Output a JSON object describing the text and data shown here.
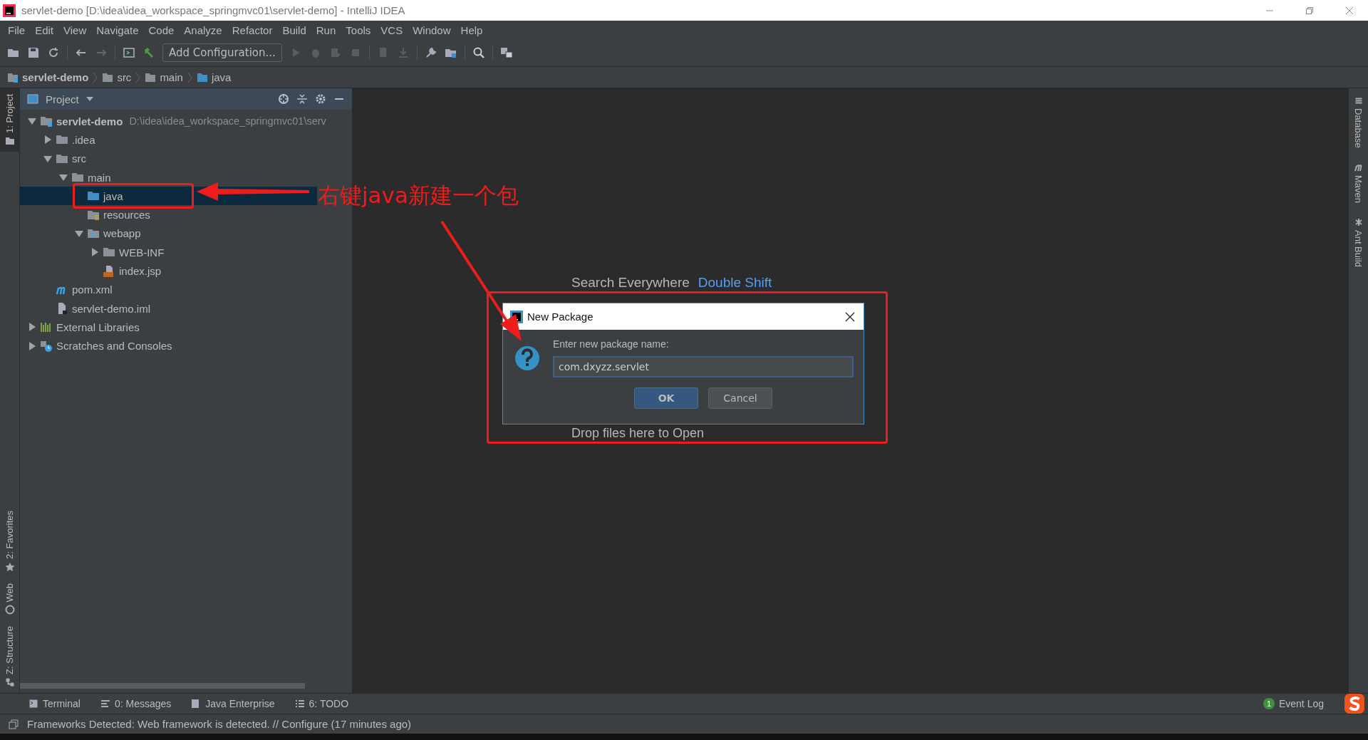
{
  "window": {
    "title": "servlet-demo [D:\\idea\\idea_workspace_springmvc01\\servlet-demo] - IntelliJ IDEA"
  },
  "menu": [
    "File",
    "Edit",
    "View",
    "Navigate",
    "Code",
    "Analyze",
    "Refactor",
    "Build",
    "Run",
    "Tools",
    "VCS",
    "Window",
    "Help"
  ],
  "toolbar": {
    "run_config": "Add Configuration..."
  },
  "breadcrumbs": [
    {
      "label": "servlet-demo",
      "kind": "module"
    },
    {
      "label": "src",
      "kind": "folder"
    },
    {
      "label": "main",
      "kind": "folder"
    },
    {
      "label": "java",
      "kind": "source"
    }
  ],
  "left_tabs": [
    {
      "label": "1: Project",
      "selected": true,
      "kind": "project"
    },
    {
      "label": "2: Favorites",
      "selected": false,
      "kind": "favorites"
    },
    {
      "label": "Web",
      "selected": false,
      "kind": "web"
    },
    {
      "label": "Z: Structure",
      "selected": false,
      "kind": "structure"
    }
  ],
  "right_tabs": [
    {
      "label": "Database",
      "kind": "database"
    },
    {
      "label": "Maven",
      "kind": "maven"
    },
    {
      "label": "Ant Build",
      "kind": "ant"
    }
  ],
  "project": {
    "title": "Project",
    "tree": [
      {
        "label": "servlet-demo",
        "path": "D:\\idea\\idea_workspace_springmvc01\\serv",
        "kind": "module",
        "expanded": true,
        "selected": false,
        "children": [
          {
            "label": ".idea",
            "kind": "folder",
            "expanded": false,
            "selected": false
          },
          {
            "label": "src",
            "kind": "folder",
            "expanded": true,
            "selected": false,
            "children": [
              {
                "label": "main",
                "kind": "folder",
                "expanded": true,
                "selected": false,
                "children": [
                  {
                    "label": "java",
                    "kind": "source",
                    "selected": true
                  },
                  {
                    "label": "resources",
                    "kind": "resources",
                    "selected": false
                  },
                  {
                    "label": "webapp",
                    "kind": "web",
                    "expanded": true,
                    "selected": false,
                    "children": [
                      {
                        "label": "WEB-INF",
                        "kind": "folder",
                        "expanded": false,
                        "selected": false
                      },
                      {
                        "label": "index.jsp",
                        "kind": "jsp",
                        "selected": false
                      }
                    ]
                  }
                ]
              }
            ]
          },
          {
            "label": "pom.xml",
            "kind": "maven",
            "selected": false
          },
          {
            "label": "servlet-demo.iml",
            "kind": "iml",
            "selected": false
          }
        ]
      },
      {
        "label": "External Libraries",
        "kind": "libraries",
        "expanded": false,
        "selected": false
      },
      {
        "label": "Scratches and Consoles",
        "kind": "scratches",
        "expanded": false,
        "selected": false
      }
    ]
  },
  "editor": {
    "hint": {
      "label": "Search Everywhere",
      "shortcut": "Double Shift"
    },
    "drop": "Drop files here to Open"
  },
  "dialog": {
    "title": "New Package",
    "prompt": "Enter new package name:",
    "value": "com.dxyzz.servlet",
    "buttons": [
      {
        "label": "OK",
        "default": true
      },
      {
        "label": "Cancel",
        "default": false
      }
    ]
  },
  "annotation": {
    "text": "右键java新建一个包"
  },
  "tool_tabs": [
    {
      "label": "Terminal",
      "kind": "terminal"
    },
    {
      "label": "0: Messages",
      "kind": "messages"
    },
    {
      "label": "Java Enterprise",
      "kind": "enterprise"
    },
    {
      "label": "6: TODO",
      "kind": "todo"
    }
  ],
  "event_log": {
    "count": "1",
    "label": "Event Log"
  },
  "status": "Frameworks Detected: Web framework is detected. // Configure (17 minutes ago)"
}
